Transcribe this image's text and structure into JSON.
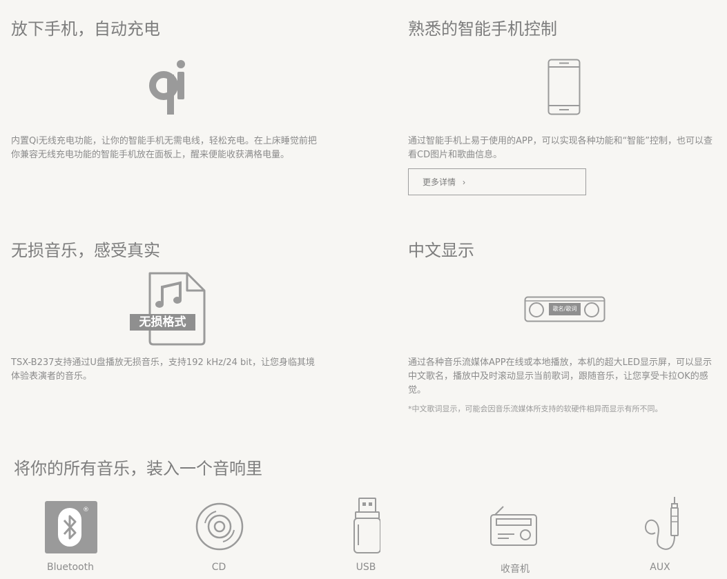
{
  "features": [
    {
      "title": "放下手机，自动充电",
      "description": "内置Qi无线充电功能，让你的智能手机无需电线，轻松充电。在上床睡觉前把你兼容无线充电功能的智能手机放在面板上，醒来便能收获满格电量。",
      "icon": "qi-wireless-charging-icon"
    },
    {
      "title": "熟悉的智能手机控制",
      "description": "通过智能手机上易于使用的APP，可以实现各种功能和“智能”控制，也可以查看CD图片和歌曲信息。",
      "icon": "smartphone-icon",
      "button_label": "更多详情",
      "button_chevron": "›"
    },
    {
      "title": "无损音乐，感受真实",
      "description": "TSX-B237支持通过U盘播放无损音乐，支持192 kHz/24 bit，让您身临其境体验表演者的音乐。",
      "icon": "lossless-file-icon",
      "icon_text": "无损格式"
    },
    {
      "title": "中文显示",
      "description": "通过各种音乐流媒体APP在线或本地播放，本机的超大LED显示屏，可以显示中文歌名，播放中及时滚动显示当前歌词，跟随音乐，让您享受卡拉OK的感觉。",
      "note": "*中文歌词显示，可能会因音乐流媒体所支持的软硬件相异而显示有所不同。",
      "icon": "led-display-icon",
      "icon_text": "歌名/歌词"
    }
  ],
  "sources_section": {
    "title": "将你的所有音乐，装入一个音响里",
    "items": [
      {
        "label": "Bluetooth",
        "icon": "bluetooth-icon",
        "mark": "®"
      },
      {
        "label": "CD",
        "icon": "cd-icon"
      },
      {
        "label": "USB",
        "icon": "usb-drive-icon"
      },
      {
        "label": "收音机",
        "icon": "radio-icon"
      },
      {
        "label": "AUX",
        "icon": "aux-cable-icon"
      }
    ]
  },
  "colors": {
    "background": "#f7f6f3",
    "icon_gray": "#9a9a9a",
    "text_gray": "#8b8b8b"
  }
}
